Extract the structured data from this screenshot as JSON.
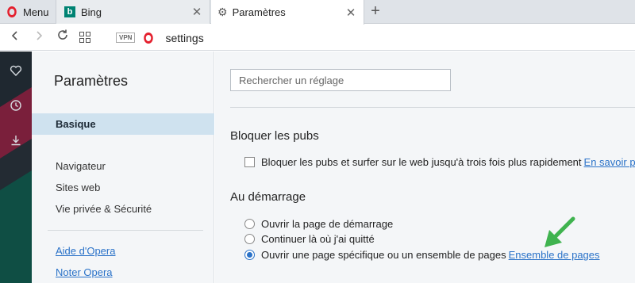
{
  "tabstrip": {
    "menu_label": "Menu",
    "tabs": [
      {
        "title": "Bing",
        "icon": "bing-icon"
      },
      {
        "title": "Paramètres",
        "icon": "gear-icon",
        "active": true
      }
    ],
    "close_glyph": "✕",
    "new_tab_glyph": "+"
  },
  "toolbar": {
    "vpn_label": "VPN",
    "url": "settings"
  },
  "settings_nav": {
    "title": "Paramètres",
    "items": [
      {
        "label": "Basique",
        "active": true
      },
      {
        "label": "Navigateur"
      },
      {
        "label": "Sites web"
      },
      {
        "label": "Vie privée & Sécurité"
      }
    ],
    "links": [
      {
        "label": "Aide d'Opera"
      },
      {
        "label": "Noter Opera"
      }
    ]
  },
  "main": {
    "search_placeholder": "Rechercher un réglage",
    "ads": {
      "title": "Bloquer les pubs",
      "checkbox_label": "Bloquer les pubs et surfer sur le web jusqu'à trois fois plus rapidement",
      "link": "En savoir plus",
      "checked": false
    },
    "startup": {
      "title": "Au démarrage",
      "options": [
        {
          "label": "Ouvrir la page de démarrage",
          "checked": false
        },
        {
          "label": "Continuer là où j'ai quitté",
          "checked": false
        },
        {
          "label": "Ouvrir une page spécifique ou un ensemble de pages",
          "checked": true,
          "link": "Ensemble de pages"
        }
      ]
    }
  },
  "colors": {
    "accent": "#2a72c8",
    "opera_red": "#e4202e",
    "annotation_arrow": "#3fb34f",
    "sidebar_dark": "#1f2830"
  }
}
